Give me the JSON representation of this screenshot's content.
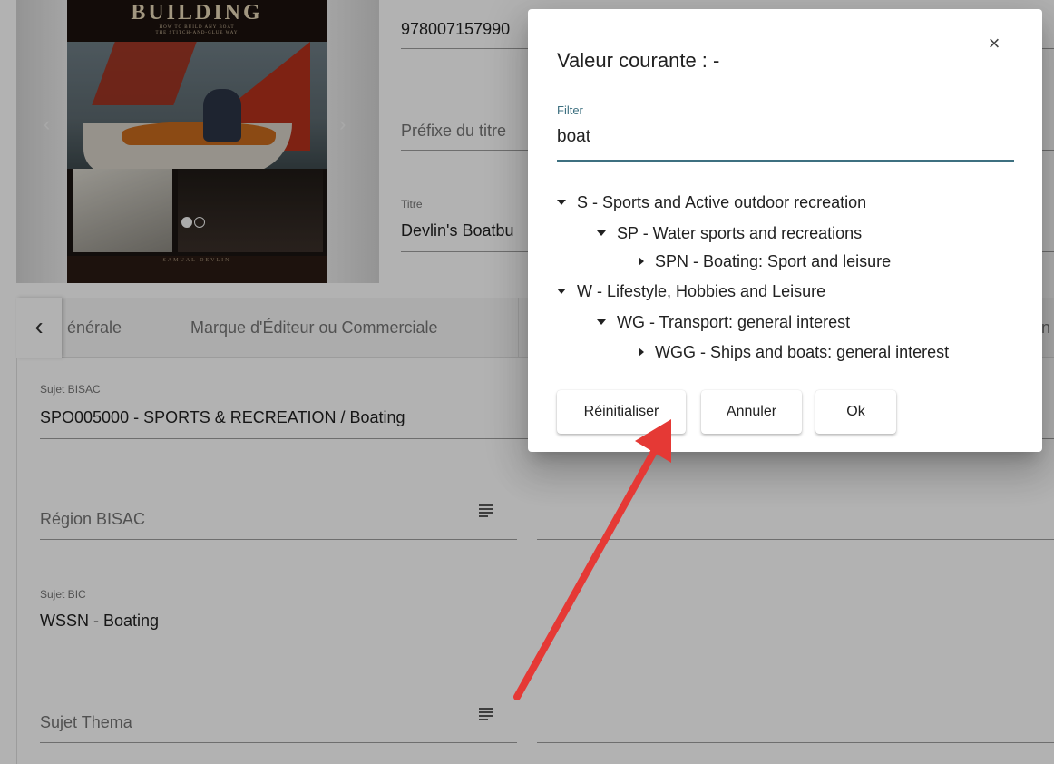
{
  "book": {
    "cover_title": "BUILDING",
    "cover_subtitle_1": "HOW TO BUILD ANY BOAT",
    "cover_subtitle_2": "THE STITCH-AND-GLUE WAY",
    "cover_author": "SAMUAL DEVLIN",
    "prev_arrow": "‹",
    "next_arrow": "›"
  },
  "fields": {
    "isbn_value": "978007157990",
    "prefix_placeholder": "Préfixe du titre",
    "title_label": "Titre",
    "title_value": "Devlin's Boatbu",
    "bisac_subject_label": "Sujet BISAC",
    "bisac_subject_value": "SPO005000 - SPORTS & RECREATION / Boating",
    "bisac_region_placeholder": "Région BISAC",
    "bic_subject_label": "Sujet BIC",
    "bic_subject_value": "WSSN - Boating",
    "thema_subject_placeholder": "Sujet Thema"
  },
  "tabs": {
    "back_icon": "‹",
    "items": [
      "énérale",
      "Marque d'Éditeur ou Commerciale"
    ],
    "right_edge": "n"
  },
  "dialog": {
    "title": "Valeur courante : -",
    "close_icon": "×",
    "filter_label": "Filter",
    "filter_value": "boat",
    "tree": [
      {
        "label": "S - Sports and Active outdoor recreation",
        "expanded": true
      },
      {
        "label": "SP - Water sports and recreations",
        "expanded": true
      },
      {
        "label": "SPN - Boating: Sport and leisure",
        "expanded": false
      },
      {
        "label": "W - Lifestyle, Hobbies and Leisure",
        "expanded": true
      },
      {
        "label": "WG - Transport: general interest",
        "expanded": true
      },
      {
        "label": "WGG - Ships and boats: general interest",
        "expanded": false
      }
    ],
    "buttons": {
      "reset": "Réinitialiser",
      "cancel": "Annuler",
      "ok": "Ok"
    }
  },
  "colors": {
    "accent": "#3d7080",
    "annotation_arrow": "#e53935"
  }
}
